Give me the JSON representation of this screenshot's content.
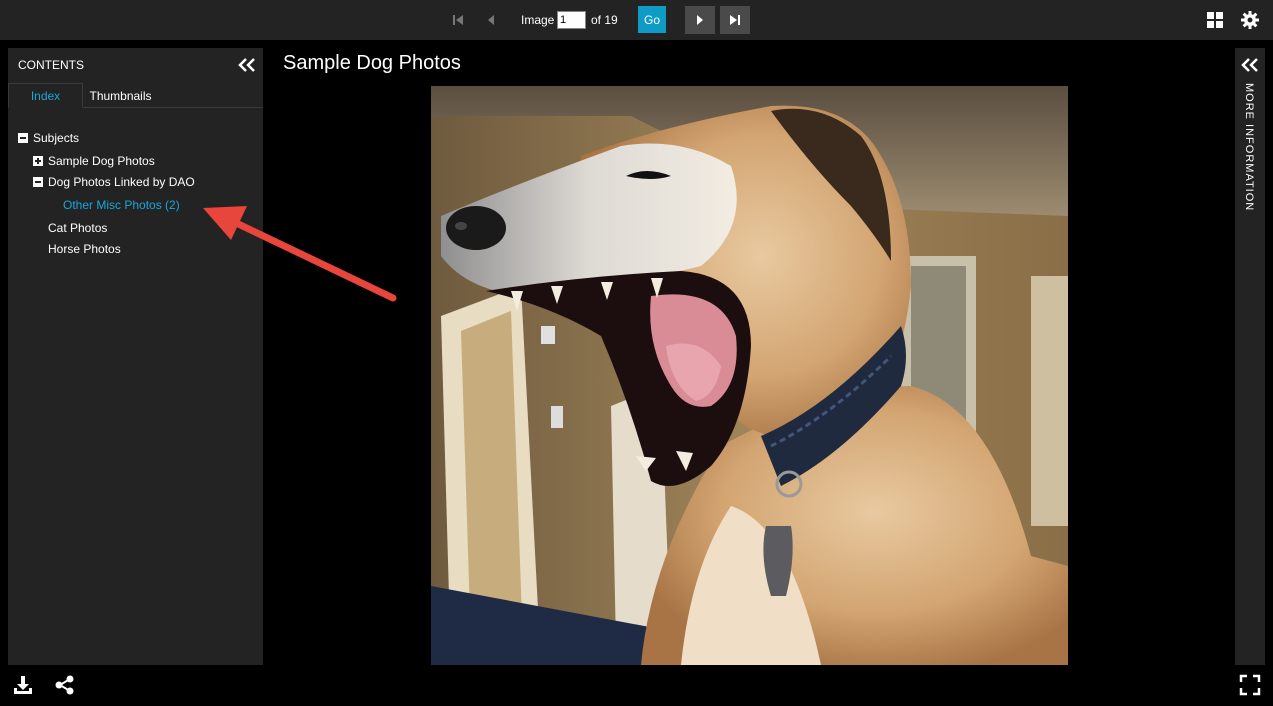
{
  "toolbar": {
    "image_label": "Image",
    "image_value": "1",
    "of_label": "of 19",
    "go_label": "Go"
  },
  "contents": {
    "title": "CONTENTS",
    "tabs": [
      {
        "label": "Index",
        "active": true
      },
      {
        "label": "Thumbnails",
        "active": false
      }
    ],
    "tree": {
      "root": "Subjects",
      "items": [
        {
          "label": "Sample Dog Photos",
          "state": "collapsed"
        },
        {
          "label": "Dog Photos Linked by DAO",
          "state": "expanded"
        },
        {
          "label": "Other Misc Photos (2)",
          "state": "selected"
        },
        {
          "label": "Cat Photos",
          "state": "leaf"
        },
        {
          "label": "Horse Photos",
          "state": "leaf"
        }
      ]
    }
  },
  "main": {
    "title": "Sample Dog Photos"
  },
  "right_panel": {
    "label": "MORE INFORMATION"
  },
  "colors": {
    "accent": "#0e9bc5",
    "link": "#17a8d8",
    "panel": "#232323",
    "annotation_arrow": "#e8453c"
  },
  "icons": [
    "first-page-icon",
    "prev-page-icon",
    "next-page-icon",
    "last-page-icon",
    "grid-view-icon",
    "settings-gear-icon",
    "collapse-left-icon",
    "collapse-right-icon",
    "download-icon",
    "share-icon",
    "fullscreen-icon"
  ]
}
